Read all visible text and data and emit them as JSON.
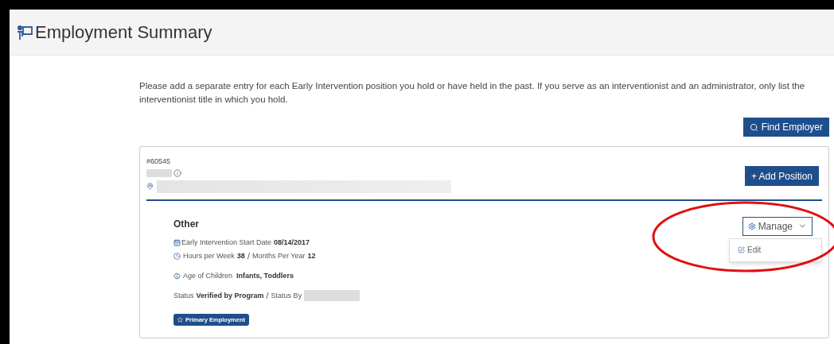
{
  "page_title": "Employment Summary",
  "instructions": "Please add a separate entry for each Early Intervention position you hold or have held in the past. If you serve as an interventionist and an administrator, only list the interventionist title in which you hold.",
  "find_employer_button": "Find Employer",
  "employer": {
    "number": "#60545",
    "add_position_button": "+ Add Position"
  },
  "position": {
    "title": "Other",
    "start_date_label": "Early Intervention Start Date",
    "start_date": "08/14/2017",
    "hours_label": "Hours per Week",
    "hours": "38",
    "separator": "/",
    "months_label": "Months Per Year",
    "months": "12",
    "age_label": "Age of Children",
    "age": "Infants, Toddlers",
    "status_label": "Status",
    "status": "Verified by Program",
    "status_separator": "/",
    "status_by_label": "Status By",
    "badge": "Primary Employment",
    "manage_button": "Manage",
    "manage_expanded": true,
    "menu_items": [
      "Edit"
    ]
  }
}
